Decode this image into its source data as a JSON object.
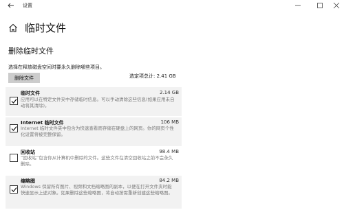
{
  "window": {
    "title": "设置"
  },
  "header": {
    "page_title": "临时文件"
  },
  "section": {
    "heading": "删除临时文件",
    "instruction": "选择在释放磁盘空间时要永久删除哪些项目。",
    "delete_button_label": "删除文件",
    "total_selected": "选定项总计: 2.41 GB"
  },
  "items": [
    {
      "name": "临时文件",
      "size": "2.14 GB",
      "checked": true,
      "description": "应用可以在特定文件夹中存储临时信息。可以手动清除这些信息(如果应用未自动将其清除)。"
    },
    {
      "name": "Internet 临时文件",
      "size": "106 MB",
      "checked": true,
      "description": "Internet 临时文件夹中包含为快速查看而存储在硬盘上的网页。你的网页个性化设置将被完整保留。"
    },
    {
      "name": "回收站",
      "size": "98.4 MB",
      "checked": false,
      "description": "“回收站”包含你从计算机中删除的文件。这些文件在清空回收站之前不会永久删除。"
    },
    {
      "name": "缩略图",
      "size": "84.2 MB",
      "checked": true,
      "description": "Windows 保留所有图片、视频和文档缩略图的副本，以便在打开文件夹时能快速显示上述对象。如果删除这些缩略图，将自动按需重新创建这些缩略图。"
    }
  ]
}
